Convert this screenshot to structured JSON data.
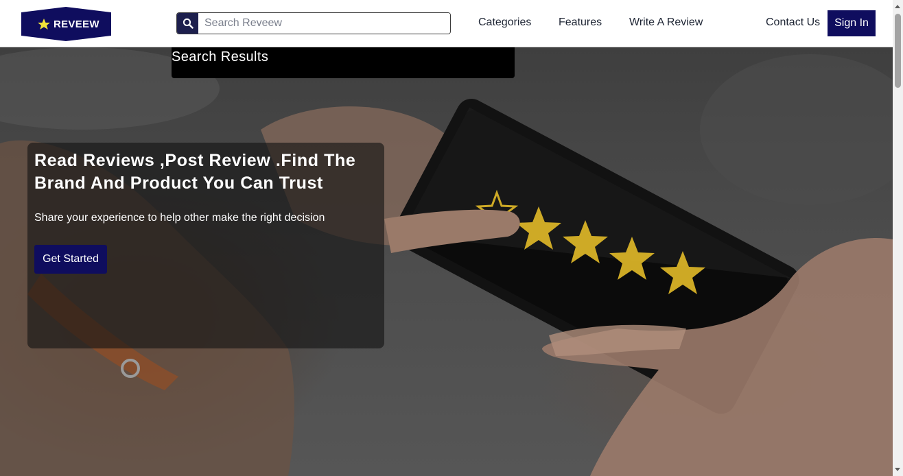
{
  "brand": {
    "name": "REVEEW",
    "color": "#0f0d5e",
    "star_color": "#f2e33a"
  },
  "search": {
    "placeholder": "Search Reveew",
    "value": "",
    "icon": "search-icon"
  },
  "nav": {
    "links": [
      "Categories",
      "Features",
      "Write A Review",
      "Contact Us"
    ],
    "signin_label": "Sign In"
  },
  "search_results": {
    "title": "Search Results"
  },
  "hero": {
    "title": "Read Reviews ,Post Review .Find The Brand And Product You Can Trust",
    "subtitle": "Share your experience to help other make the right decision",
    "cta_label": "Get Started",
    "image_description_icon": "phone-rating-stars"
  },
  "colors": {
    "accent": "#0f0d5e",
    "stars": "#d8b227"
  }
}
